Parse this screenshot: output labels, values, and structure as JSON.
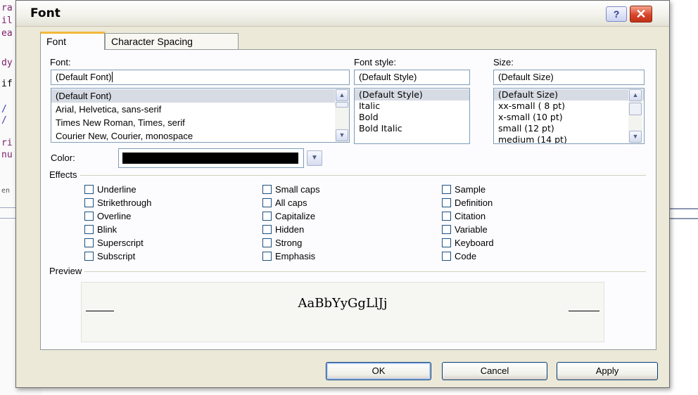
{
  "background_code": {
    "lines": [
      "ra",
      "il",
      "ea",
      "dy",
      "if",
      "/",
      "/",
      "ri",
      "nu",
      "en"
    ]
  },
  "dialog": {
    "title": "Font",
    "help_symbol": "?",
    "close_symbol": "✕"
  },
  "tabs": [
    {
      "label": "Font",
      "active": true
    },
    {
      "label": "Character Spacing",
      "active": false
    }
  ],
  "font": {
    "label": "Font:",
    "value": "(Default Font)",
    "options": [
      "(Default Font)",
      "Arial, Helvetica, sans-serif",
      "Times New Roman, Times, serif",
      "Courier New, Courier, monospace"
    ],
    "selected_index": 0
  },
  "font_style": {
    "label": "Font style:",
    "value": "(Default Style)",
    "options": [
      "(Default Style)",
      "Italic",
      "Bold",
      "Bold Italic"
    ],
    "selected_index": 0
  },
  "size": {
    "label": "Size:",
    "value": "(Default Size)",
    "options": [
      "(Default Size)",
      "xx-small ( 8 pt)",
      "x-small   (10 pt)",
      "small      (12 pt)",
      "medium  (14 pt)"
    ],
    "selected_index": 0
  },
  "color": {
    "label": "Color:",
    "value": "#000000"
  },
  "effects": {
    "label": "Effects",
    "columns": [
      [
        "Underline",
        "Strikethrough",
        "Overline",
        "Blink",
        "Superscript",
        "Subscript"
      ],
      [
        "Small caps",
        "All caps",
        "Capitalize",
        "Hidden",
        "Strong",
        "Emphasis"
      ],
      [
        "Sample",
        "Definition",
        "Citation",
        "Variable",
        "Keyboard",
        "Code"
      ]
    ]
  },
  "preview": {
    "label": "Preview",
    "text": "AaBbYyGgLlJj"
  },
  "buttons": {
    "ok": "OK",
    "cancel": "Cancel",
    "apply": "Apply"
  }
}
